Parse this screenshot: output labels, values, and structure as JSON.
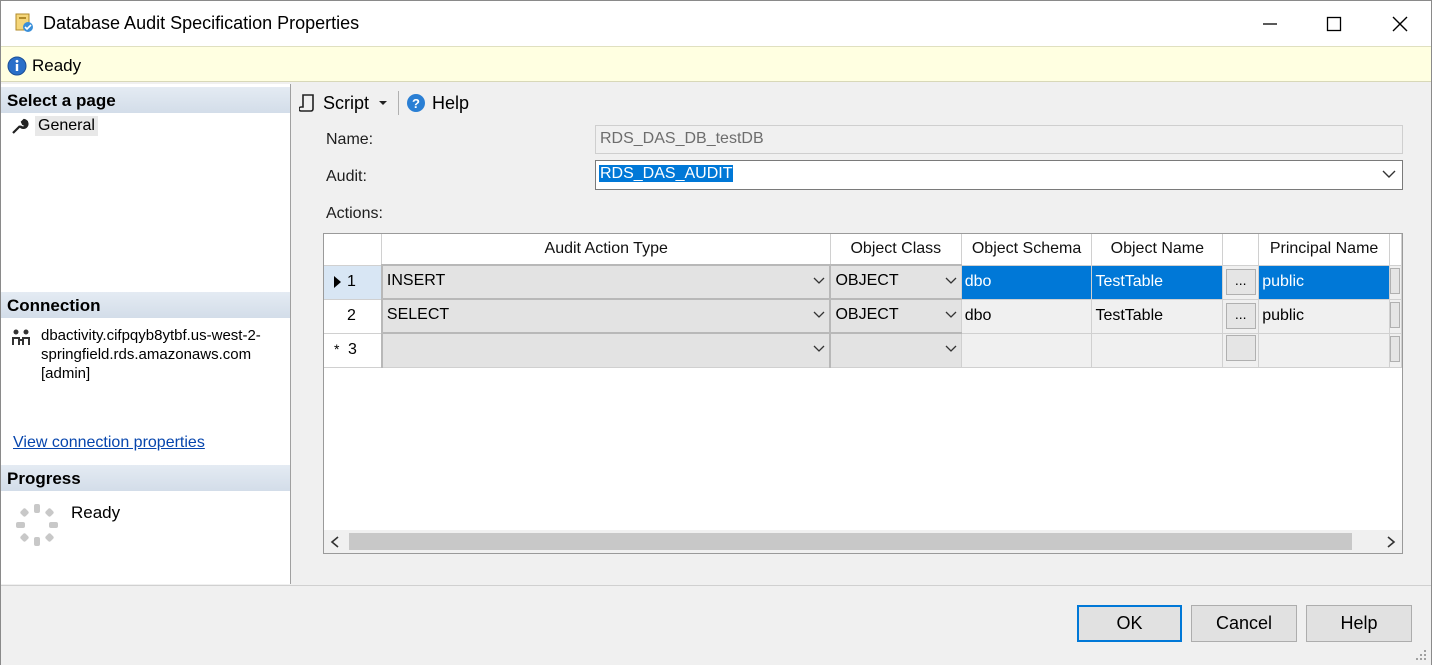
{
  "window": {
    "title": "Database Audit Specification Properties",
    "minimize_icon": "minimize-icon",
    "maximize_icon": "maximize-icon",
    "close_icon": "close-icon"
  },
  "status": {
    "text": "Ready",
    "icon": "info-icon"
  },
  "left": {
    "select_page_header": "Select a page",
    "pages": [
      {
        "label": "General",
        "icon": "wrench-icon"
      }
    ],
    "connection_header": "Connection",
    "connection_text": "dbactivity.cifpqyb8ytbf.us-west-2-springfield.rds.amazonaws.com [admin]",
    "connection_link": "View connection properties",
    "progress_header": "Progress",
    "progress_text": "Ready"
  },
  "toolbar": {
    "script_label": "Script",
    "help_label": "Help"
  },
  "form": {
    "name_label": "Name:",
    "name_value": "RDS_DAS_DB_testDB",
    "audit_label": "Audit:",
    "audit_value": "RDS_DAS_AUDIT",
    "actions_label": "Actions:"
  },
  "grid": {
    "columns": [
      "Audit Action Type",
      "Object Class",
      "Object Schema",
      "Object Name",
      "Principal Name"
    ],
    "ellipsis": "...",
    "rows": [
      {
        "num": "1",
        "action": "INSERT",
        "object_class": "OBJECT",
        "schema": "dbo",
        "name": "TestTable",
        "principal": "public",
        "selected": true
      },
      {
        "num": "2",
        "action": "SELECT",
        "object_class": "OBJECT",
        "schema": "dbo",
        "name": "TestTable",
        "principal": "public",
        "selected": false
      },
      {
        "num": "3",
        "action": "",
        "object_class": "",
        "schema": "",
        "name": "",
        "principal": "",
        "selected": false
      }
    ],
    "new_row_marker": "*"
  },
  "buttons": {
    "ok": "OK",
    "cancel": "Cancel",
    "help": "Help"
  },
  "colors": {
    "accent": "#0078d7",
    "status_bg": "#ffffe1"
  }
}
